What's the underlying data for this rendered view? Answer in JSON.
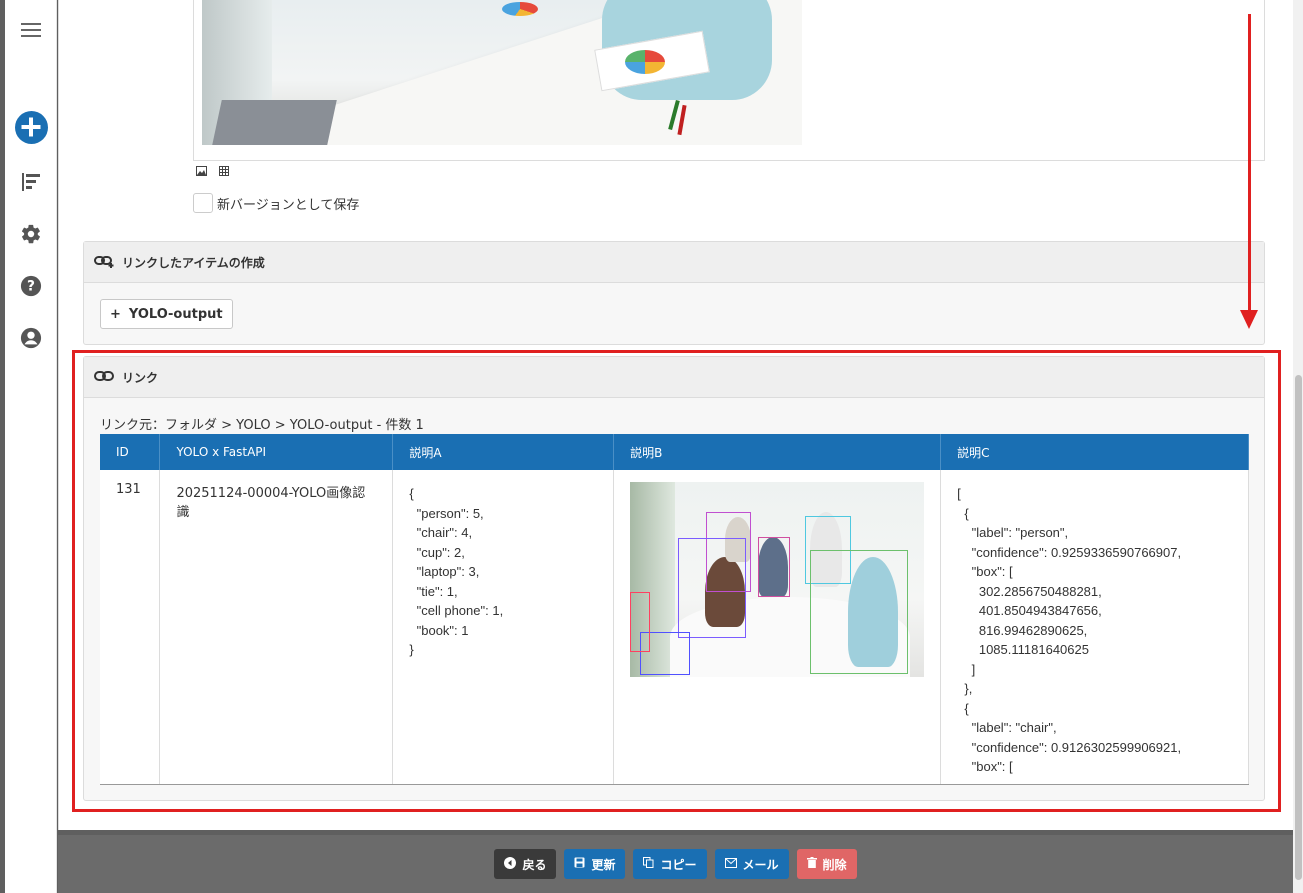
{
  "sidebar": {
    "menu_icon": "hamburger-icon",
    "add_icon": "plus-circle-icon",
    "sort_icon": "sort-icon",
    "settings_icon": "gear-icon",
    "help_icon": "question-icon",
    "user_icon": "user-icon"
  },
  "editor": {
    "save_as_new_version": "新バージョンとして保存"
  },
  "linked_create": {
    "title": "リンクしたアイテムの作成",
    "button_label": "YOLO-output"
  },
  "links": {
    "title": "リンク",
    "source": "リンク元：フォルダ > YOLO > YOLO-output - 件数 1",
    "columns": [
      "ID",
      "YOLO x FastAPI",
      "説明A",
      "説明B",
      "説明C"
    ],
    "rows": [
      {
        "id": "131",
        "name": "20251124-00004-YOLO画像認識",
        "desc_a": "{\n  \"person\": 5,\n  \"chair\": 4,\n  \"cup\": 2,\n  \"laptop\": 3,\n  \"tie\": 1,\n  \"cell phone\": 1,\n  \"book\": 1\n}",
        "desc_c": "[\n  {\n    \"label\": \"person\",\n    \"confidence\": 0.9259336590766907,\n    \"box\": [\n      302.2856750488281,\n      401.8504943847656,\n      816.99462890625,\n      1085.11181640625\n    ]\n  },\n  {\n    \"label\": \"chair\",\n    \"confidence\": 0.9126302599906921,\n    \"box\": ["
      }
    ]
  },
  "footer": {
    "back": "戻る",
    "update": "更新",
    "copy": "コピー",
    "mail": "メール",
    "delete": "削除"
  },
  "colors": {
    "primary": "#1a6fb3",
    "danger": "#e06666",
    "annotation": "#e02020"
  }
}
